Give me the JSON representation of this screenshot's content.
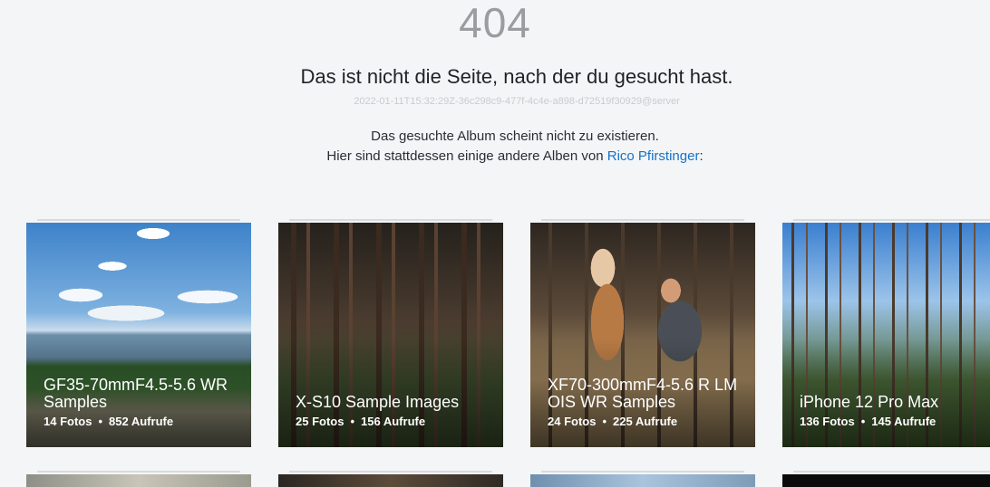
{
  "error": {
    "code": "404",
    "headline": "Das ist nicht die Seite, nach der du gesucht hast.",
    "request_id": "2022-01-11T15:32:29Z-36c298c9-477f-4c4e-a898-d72519f30929@server"
  },
  "message": {
    "line1": "Das gesuchte Album scheint nicht zu existieren.",
    "line2_prefix": "Hier sind stattdessen einige andere Alben von ",
    "owner_name": "Rico Pfirstinger",
    "line2_suffix": ":"
  },
  "albums": [
    {
      "title": "GF35-70mmF4.5-5.6 WR Samples",
      "photos": "14 Fotos",
      "views": "852 Aufrufe"
    },
    {
      "title": "X-S10 Sample Images",
      "photos": "25 Fotos",
      "views": "156 Aufrufe"
    },
    {
      "title": "XF70-300mmF4-5.6 R LM OIS WR Samples",
      "photos": "24 Fotos",
      "views": "225 Aufrufe"
    },
    {
      "title": "iPhone 12 Pro Max",
      "photos": "136 Fotos",
      "views": "145 Aufrufe"
    }
  ],
  "separator": "•"
}
